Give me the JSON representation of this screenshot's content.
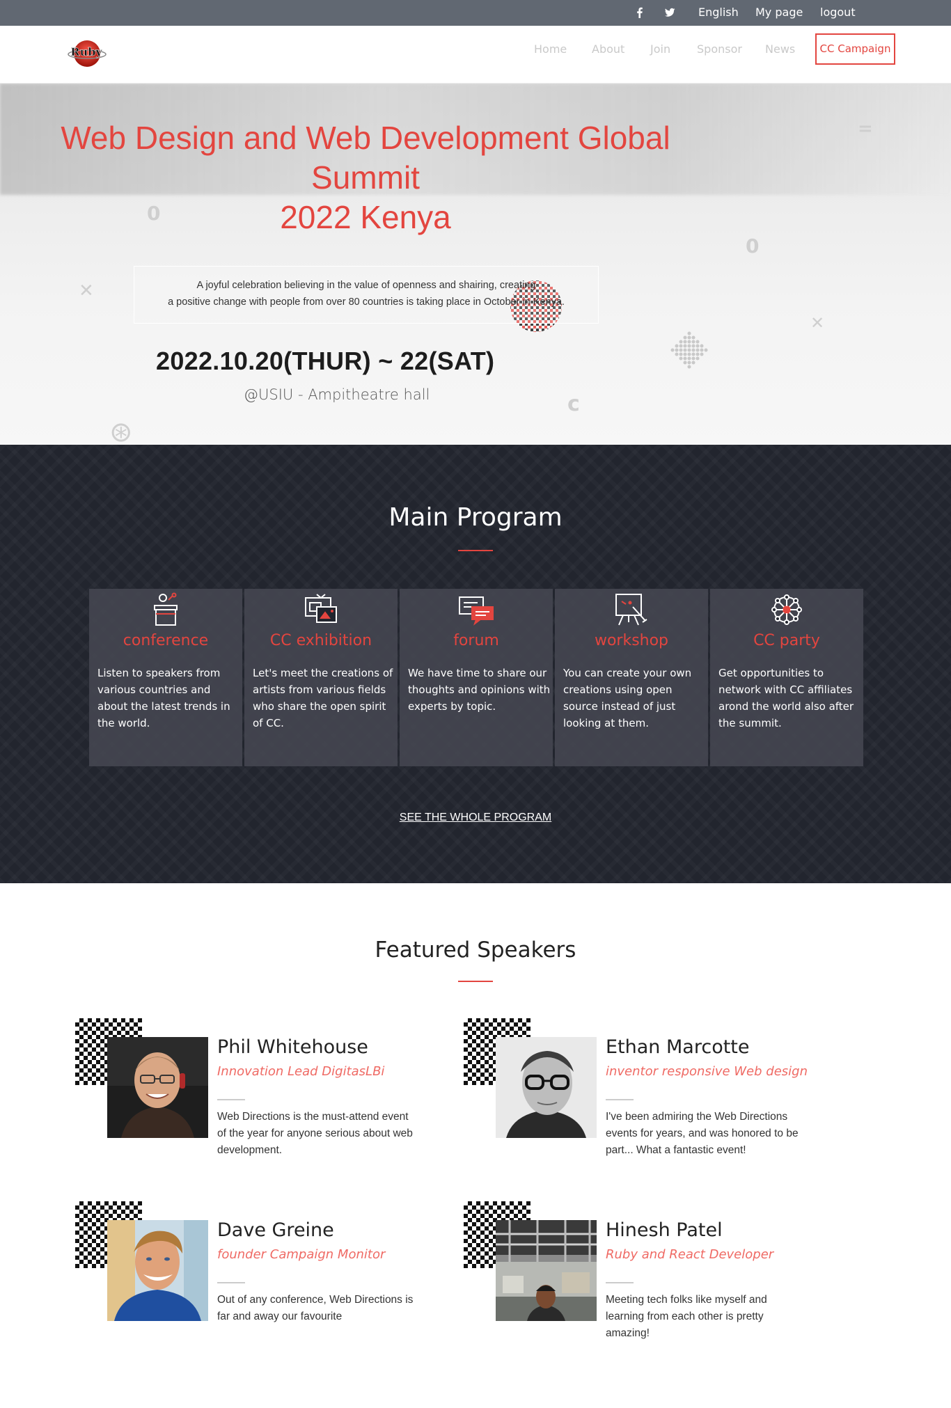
{
  "topbar": {
    "facebook_icon": "facebook-icon",
    "twitter_icon": "twitter-icon",
    "language": "English",
    "mypage": "My page",
    "logout": "logout"
  },
  "header": {
    "logo_text": "Ruby",
    "nav": [
      "Home",
      "About",
      "Join",
      "Sponsor",
      "News"
    ],
    "cta": "CC Campaign"
  },
  "hero": {
    "title_lines": [
      "Web Design and Web Development Global",
      "Summit",
      "2022 Kenya"
    ],
    "desc_lines": [
      "A joyful celebration believing in the value of openness and shairing, creating",
      "a positive change with people from over 80 countries is taking place in October in Kenya."
    ],
    "date": "2022.10.20(THUR) ~ 22(SAT)",
    "venue": "@USIU - Ampitheatre hall"
  },
  "program": {
    "title": "Main Program",
    "cards": [
      {
        "icon": "podium-icon",
        "title": "conference",
        "text": "Listen to speakers from various countries and about the latest trends in the world."
      },
      {
        "icon": "gallery-icon",
        "title": "CC exhibition",
        "text": "Let's meet the creations of artists from various fields who share the open spirit of CC."
      },
      {
        "icon": "chat-icon",
        "title": "forum",
        "text": "We have time to share our thoughts and opinions with experts by topic."
      },
      {
        "icon": "whiteboard-icon",
        "title": "workshop",
        "text": "You can create your own creations using open source instead of just looking at them."
      },
      {
        "icon": "network-icon",
        "title": "CC party",
        "text": "Get opportunities to network with CC affiliates arond the world also after the summit."
      }
    ],
    "see_all": "SEE THE WHOLE PROGRAM"
  },
  "speakers": {
    "title": "Featured Speakers",
    "items": [
      {
        "name": "Phil Whitehouse",
        "role": "Innovation Lead DigitasLBi",
        "quote": "Web Directions is the must-attend event of the year for anyone serious about web development."
      },
      {
        "name": "Ethan Marcotte",
        "role": "inventor responsive Web design",
        "quote": "I've been admiring the Web Directions events for years, and was honored to be part... What a fantastic event!"
      },
      {
        "name": "Dave Greine",
        "role": "founder Campaign Monitor",
        "quote": "Out of any conference, Web Directions is far and away our favourite"
      },
      {
        "name": "Hinesh Patel",
        "role": "Ruby and React Developer",
        "quote": "Meeting tech folks like myself and learning from each other is pretty amazing!"
      }
    ]
  },
  "colors": {
    "accent": "#e3453f",
    "dark": "#22252e",
    "topbar": "#616872"
  }
}
